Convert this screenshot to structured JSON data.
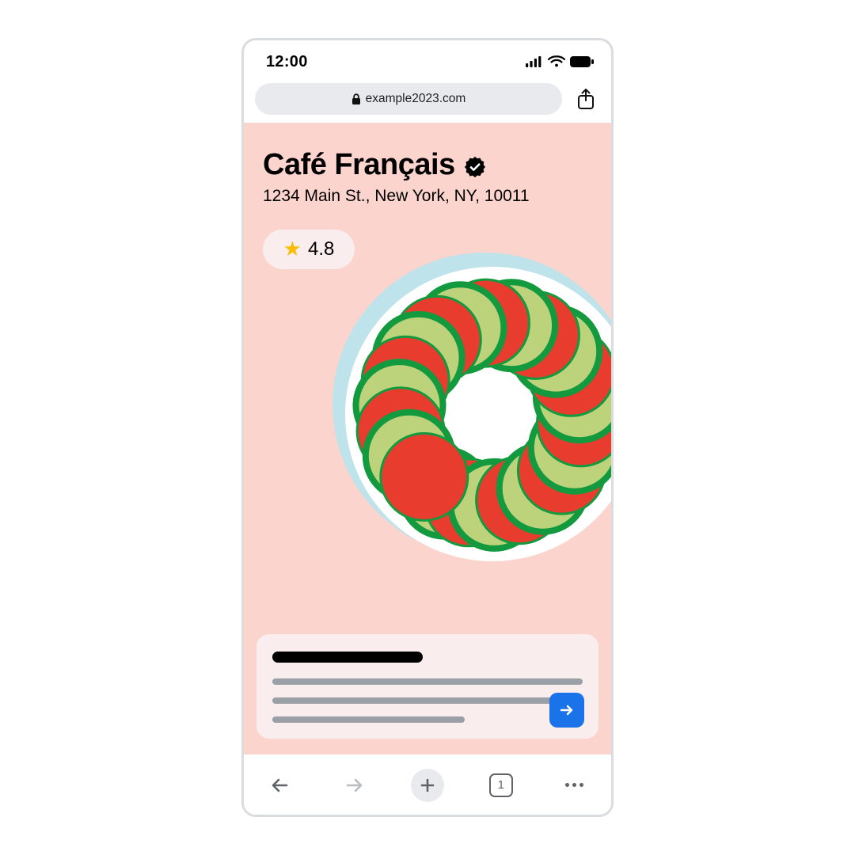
{
  "status": {
    "time": "12:00"
  },
  "browser": {
    "url": "example2023.com",
    "tab_count": "1"
  },
  "restaurant": {
    "name": "Café Français",
    "address": "1234 Main St., New York, NY, 10011",
    "rating": "4.8"
  }
}
